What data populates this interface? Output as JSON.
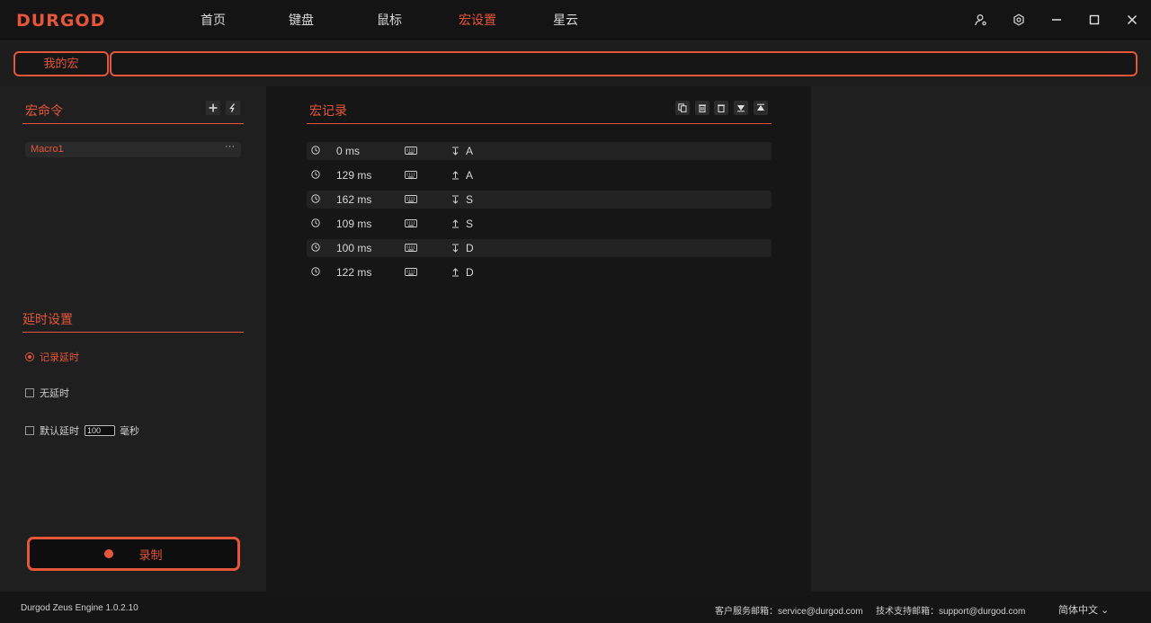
{
  "app": {
    "logo": "DURGOD"
  },
  "nav": {
    "items": [
      {
        "label": "首页"
      },
      {
        "label": "键盘"
      },
      {
        "label": "鼠标"
      },
      {
        "label": "宏设置"
      },
      {
        "label": "星云"
      }
    ],
    "active": "宏设置"
  },
  "tabs": {
    "my_macro": "我的宏"
  },
  "macro_commands": {
    "title": "宏命令",
    "items": [
      {
        "name": "Macro1",
        "menu": "···"
      }
    ]
  },
  "delay_settings": {
    "title": "延时设置",
    "record_delay": "记录延时",
    "no_delay": "无延时",
    "default_delay": "默认延时",
    "default_delay_value": "100",
    "unit": "毫秒",
    "selected": "记录延时"
  },
  "record_button": {
    "label": "录制"
  },
  "macro_record": {
    "title": "宏记录",
    "rows": [
      {
        "delay": "0 ms",
        "action": "down",
        "key": "A"
      },
      {
        "delay": "129 ms",
        "action": "up",
        "key": "A"
      },
      {
        "delay": "162 ms",
        "action": "down",
        "key": "S"
      },
      {
        "delay": "109 ms",
        "action": "up",
        "key": "S"
      },
      {
        "delay": "100 ms",
        "action": "down",
        "key": "D"
      },
      {
        "delay": "122 ms",
        "action": "up",
        "key": "D"
      }
    ]
  },
  "footer": {
    "version": "Durgod Zeus Engine 1.0.2.10",
    "service_label": "客户服务邮箱：",
    "service_email": "service@durgod.com",
    "support_label": "技术支持邮箱：",
    "support_email": "support@durgod.com",
    "language": "简体中文 ⌄"
  },
  "colors": {
    "accent": "#e5563a",
    "background": "#1b1b1b"
  }
}
